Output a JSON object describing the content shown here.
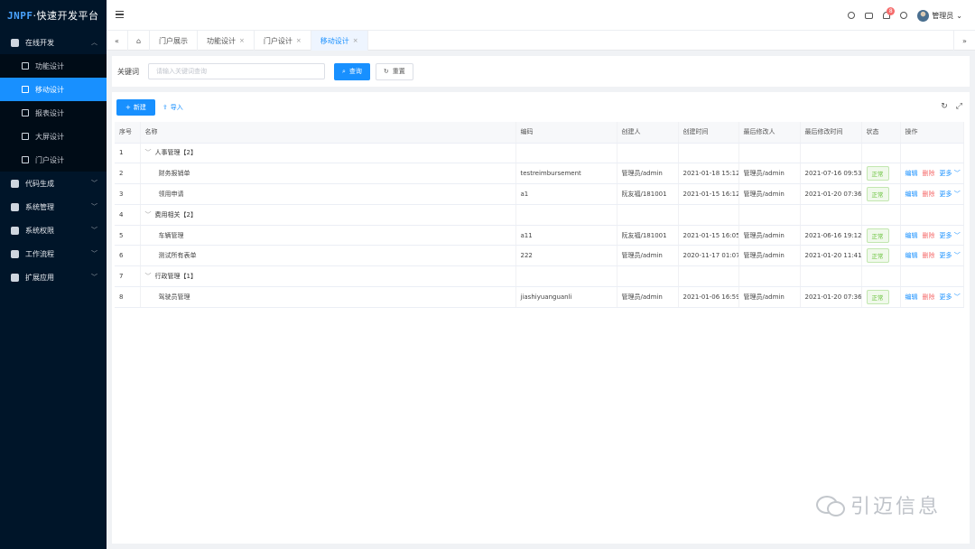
{
  "app": {
    "logo_brand": "JNPF",
    "logo_text": "·快速开发平台"
  },
  "sidebar": {
    "groups": [
      {
        "label": "在线开发",
        "expanded": true,
        "icon": "monitor-icon",
        "items": [
          {
            "label": "功能设计",
            "icon": "function-icon",
            "active": false
          },
          {
            "label": "移动设计",
            "icon": "mobile-icon",
            "active": true
          },
          {
            "label": "报表设计",
            "icon": "report-icon",
            "active": false
          },
          {
            "label": "大屏设计",
            "icon": "screen-icon",
            "active": false
          },
          {
            "label": "门户设计",
            "icon": "portal-icon",
            "active": false
          }
        ]
      },
      {
        "label": "代码生成",
        "icon": "code-icon"
      },
      {
        "label": "系统管理",
        "icon": "settings-icon"
      },
      {
        "label": "系统权限",
        "icon": "shield-icon"
      },
      {
        "label": "工作流程",
        "icon": "workflow-icon"
      },
      {
        "label": "扩展应用",
        "icon": "apps-icon"
      }
    ]
  },
  "topbar": {
    "notification_count": "8",
    "user_name": "管理员"
  },
  "tabs": {
    "items": [
      {
        "label": "门户展示",
        "closable": false
      },
      {
        "label": "功能设计",
        "closable": true
      },
      {
        "label": "门户设计",
        "closable": true
      },
      {
        "label": "移动设计",
        "closable": true,
        "active": true
      }
    ],
    "close_glyph": "×"
  },
  "search": {
    "keyword_label": "关键词",
    "placeholder": "请输入关键词查询",
    "query_button": "查询",
    "reset_button": "重置"
  },
  "toolbar": {
    "new_button": "新建",
    "import_button": "导入"
  },
  "table": {
    "headers": [
      "序号",
      "名称",
      "编码",
      "创建人",
      "创建时间",
      "最后修改人",
      "最后修改时间",
      "状态",
      "操作"
    ],
    "rows": [
      {
        "type": "group",
        "index": "1",
        "name": "人事管理【2】"
      },
      {
        "type": "item",
        "index": "2",
        "name": "财务报销单",
        "code": "testreimbursement",
        "creator": "管理员/admin",
        "created": "2021-01-18 15:12",
        "modifier": "管理员/admin",
        "modified": "2021-07-16 09:53",
        "status": "正常"
      },
      {
        "type": "item",
        "index": "3",
        "name": "领用申请",
        "code": "a1",
        "creator": "阮友福/181001",
        "created": "2021-01-15 16:12",
        "modifier": "管理员/admin",
        "modified": "2021-01-20 07:36",
        "status": "正常"
      },
      {
        "type": "group",
        "index": "4",
        "name": "费用相关【2】"
      },
      {
        "type": "item",
        "index": "5",
        "name": "车辆管理",
        "code": "a11",
        "creator": "阮友福/181001",
        "created": "2021-01-15 16:05",
        "modifier": "管理员/admin",
        "modified": "2021-06-16 19:12",
        "status": "正常"
      },
      {
        "type": "item",
        "index": "6",
        "name": "测试所有表单",
        "code": "222",
        "creator": "管理员/admin",
        "created": "2020-11-17 01:07",
        "modifier": "管理员/admin",
        "modified": "2021-01-20 11:41",
        "status": "正常"
      },
      {
        "type": "group",
        "index": "7",
        "name": "行政管理【1】"
      },
      {
        "type": "item",
        "index": "8",
        "name": "驾驶员管理",
        "code": "jiashiyuanguanli",
        "creator": "管理员/admin",
        "created": "2021-01-06 16:59",
        "modifier": "管理员/admin",
        "modified": "2021-01-20 07:36",
        "status": "正常"
      }
    ],
    "ops": {
      "edit": "编辑",
      "delete": "删除",
      "more": "更多"
    }
  },
  "watermark": {
    "text": "引迈信息"
  },
  "colors": {
    "sidebar_bg": "#001529",
    "accent": "#1890ff",
    "danger": "#f56c6c",
    "success": "#67c23a"
  }
}
